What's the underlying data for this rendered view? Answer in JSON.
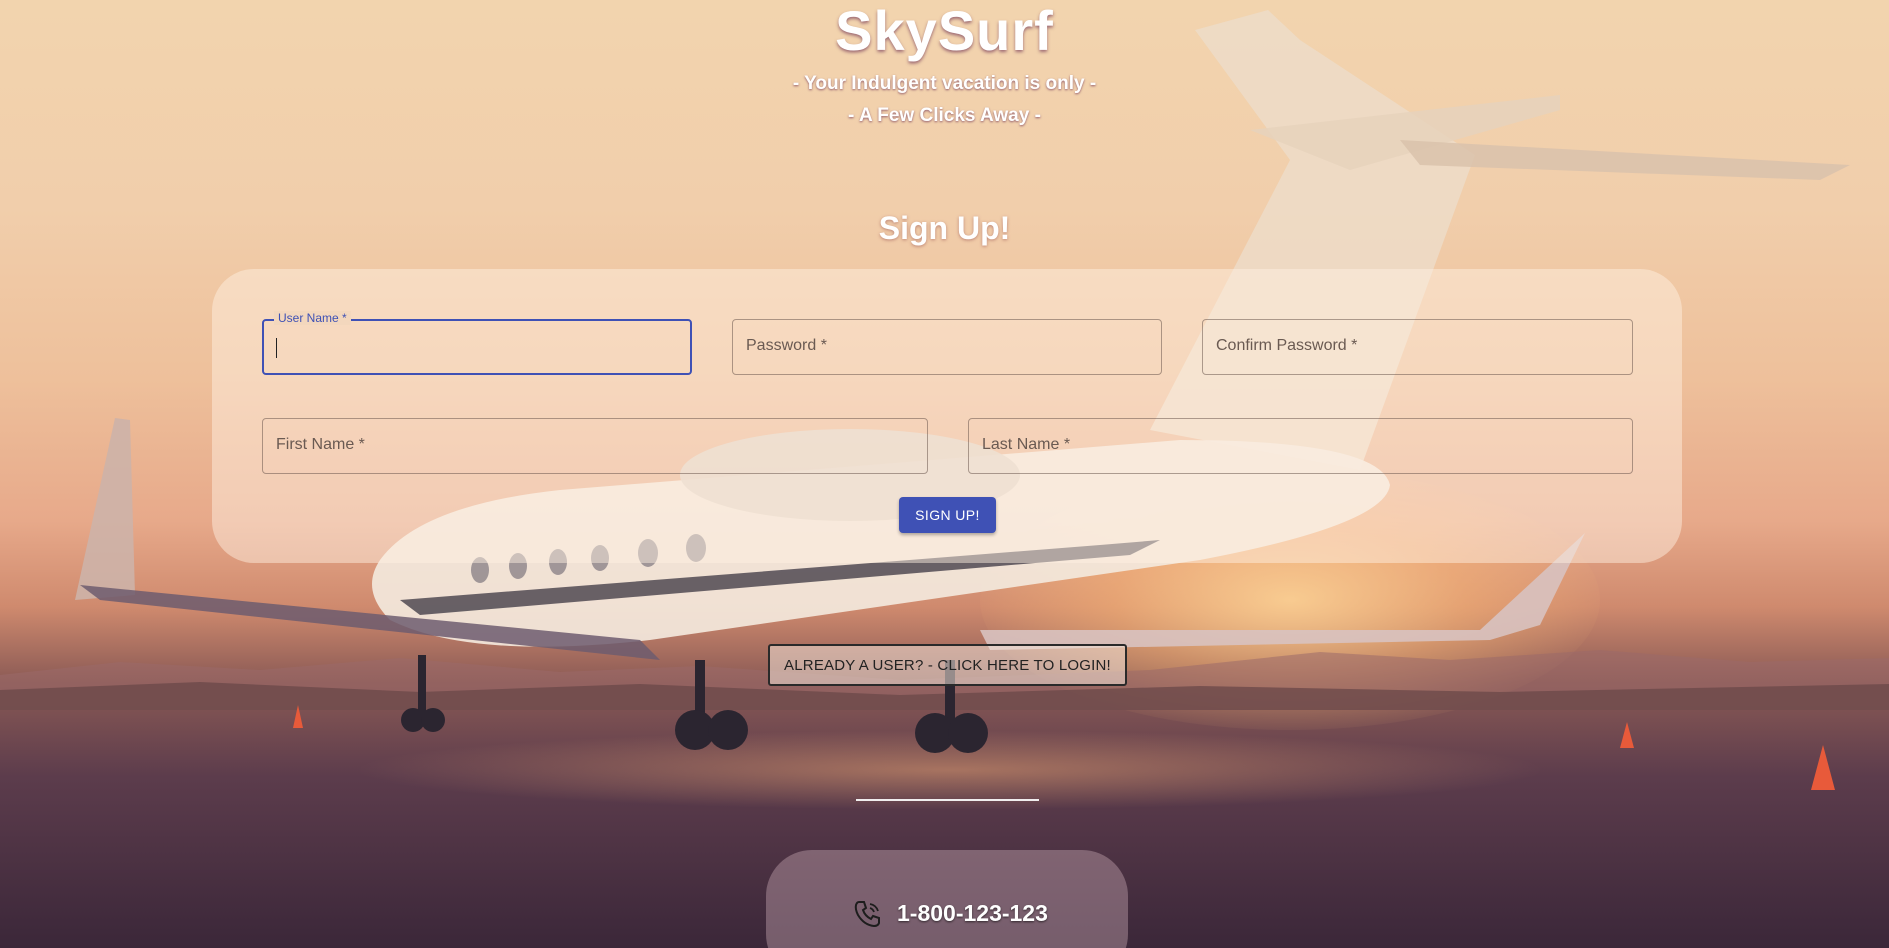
{
  "brand": {
    "title": "SkySurf",
    "tagline_1": "- Your Indulgent vacation is only -",
    "tagline_2": "- A Few Clicks Away -"
  },
  "signup": {
    "heading": "Sign Up!",
    "fields": {
      "username": {
        "label": "User Name *",
        "value": ""
      },
      "password": {
        "placeholder": "Password *"
      },
      "confirm_password": {
        "placeholder": "Confirm Password *"
      },
      "first_name": {
        "placeholder": "First Name *"
      },
      "last_name": {
        "placeholder": "Last Name *"
      }
    },
    "submit_label": "SIGN UP!"
  },
  "login_link_label": "ALREADY A USER? - CLICK HERE TO LOGIN!",
  "contact": {
    "icon": "phone-icon",
    "phone": "1-800-123-123"
  },
  "colors": {
    "primary": "#3f51b5",
    "text_light": "#ffffff"
  }
}
